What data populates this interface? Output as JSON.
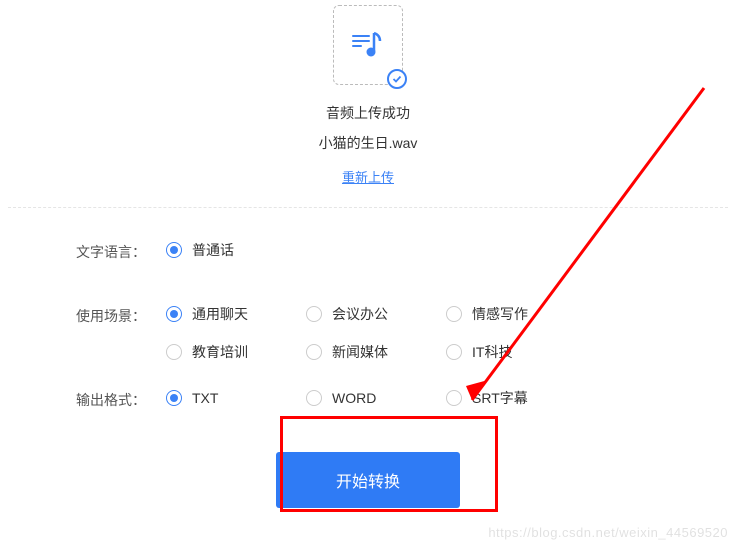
{
  "upload": {
    "status": "音频上传成功",
    "filename": "小猫的生日.wav",
    "reupload_label": "重新上传"
  },
  "form": {
    "language": {
      "label": "文字语言：",
      "options": [
        {
          "label": "普通话",
          "selected": true
        }
      ]
    },
    "scenario": {
      "label": "使用场景：",
      "options": [
        {
          "label": "通用聊天",
          "selected": true
        },
        {
          "label": "会议办公",
          "selected": false
        },
        {
          "label": "情感写作",
          "selected": false
        },
        {
          "label": "教育培训",
          "selected": false
        },
        {
          "label": "新闻媒体",
          "selected": false
        },
        {
          "label": "IT科技",
          "selected": false
        }
      ]
    },
    "format": {
      "label": "输出格式：",
      "options": [
        {
          "label": "TXT",
          "selected": true
        },
        {
          "label": "WORD",
          "selected": false
        },
        {
          "label": "SRT字幕",
          "selected": false
        }
      ]
    },
    "submit_label": "开始转换"
  },
  "watermark": "https://blog.csdn.net/weixin_44569520"
}
